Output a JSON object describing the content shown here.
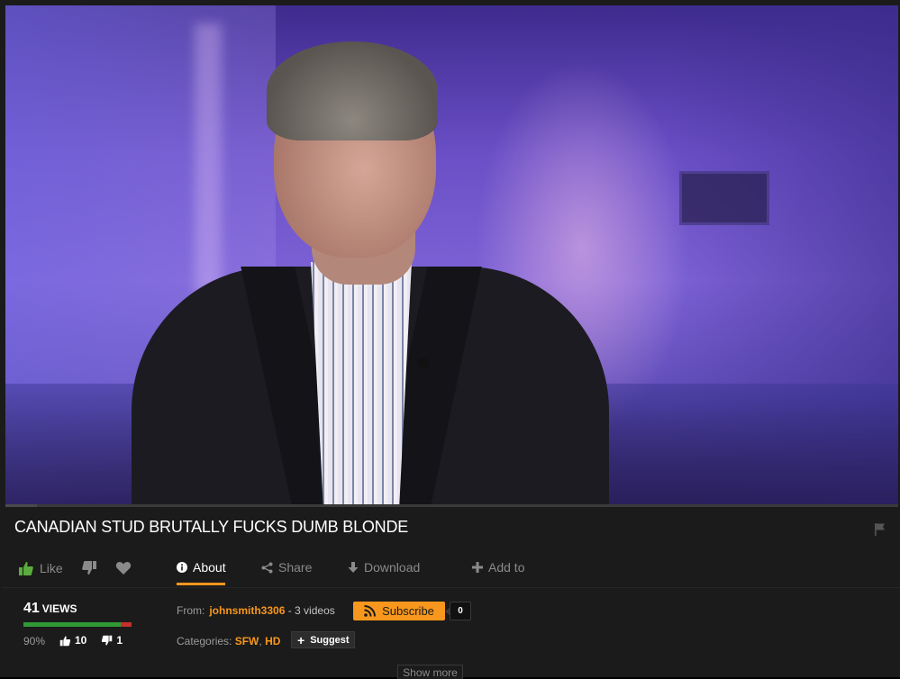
{
  "video": {
    "title": "CANADIAN STUD BRUTALLY FUCKS DUMB BLONDE",
    "progress_fraction": 0.035
  },
  "actions": {
    "like_label": "Like",
    "about_label": "About",
    "share_label": "Share",
    "download_label": "Download",
    "add_to_label": "Add to"
  },
  "stats": {
    "views_count": "41",
    "views_label": "VIEWS",
    "rating_percent": "90%",
    "rating_fraction": 0.9,
    "likes": "10",
    "dislikes": "1"
  },
  "uploader": {
    "from_label": "From:",
    "username": "johnsmith3306",
    "video_count": "- 3 videos",
    "subscribe_label": "Subscribe",
    "subscriber_count": "0"
  },
  "categories": {
    "label": "Categories:",
    "items": [
      "SFW",
      "HD"
    ],
    "separator": ",",
    "suggest_label": "Suggest"
  },
  "show_more_label": "Show more",
  "colors": {
    "accent": "#f7971d",
    "background": "#1b1b1b",
    "like_green": "#2f9a35",
    "dislike_red": "#c8302b"
  },
  "icons": [
    "thumbs-up-icon",
    "thumbs-down-icon",
    "heart-icon",
    "info-icon",
    "share-icon",
    "download-icon",
    "plus-icon",
    "rss-icon",
    "flag-icon"
  ]
}
